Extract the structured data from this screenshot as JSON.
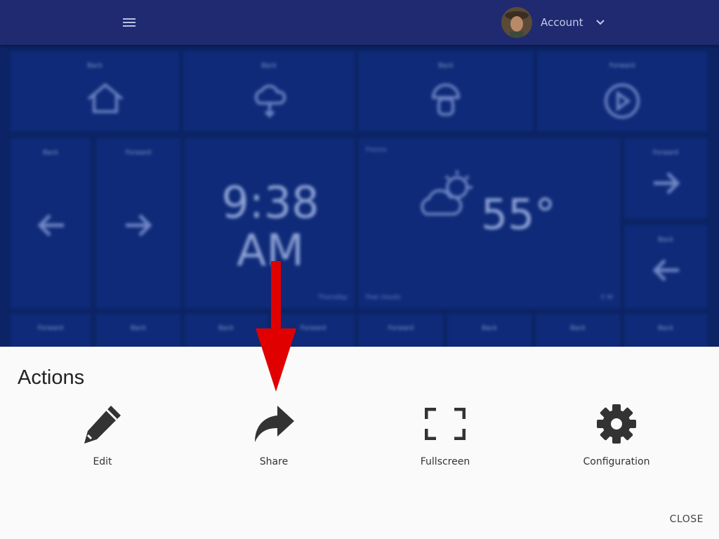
{
  "header": {
    "account_label": "Account"
  },
  "dashboard": {
    "tiles": [
      {
        "label": "Back",
        "icon": "home-icon"
      },
      {
        "label": "Back",
        "icon": "cloud-download-icon"
      },
      {
        "label": "Back",
        "icon": "mushroom-icon"
      },
      {
        "label": "Forward",
        "icon": "play-circle-icon"
      },
      {
        "label": "Back",
        "icon": "arrow-left-icon"
      },
      {
        "label": "Forward",
        "icon": "arrow-right-icon"
      },
      {
        "label": "Forward",
        "icon": "arrow-right-icon"
      },
      {
        "label": "Back",
        "icon": "arrow-left-icon"
      }
    ],
    "clock": {
      "time": "9:38",
      "period": "AM",
      "day": "Thursday"
    },
    "weather": {
      "label": "Fresno",
      "temp": "55°",
      "condition": "Few clouds",
      "wind": "5 W"
    },
    "bottom_row_labels": [
      "Forward",
      "Back",
      "Back",
      "Forward",
      "Forward",
      "Back",
      "Back",
      "Back"
    ]
  },
  "actions": {
    "title": "Actions",
    "items": [
      {
        "label": "Edit",
        "icon": "pencil-icon"
      },
      {
        "label": "Share",
        "icon": "share-icon"
      },
      {
        "label": "Fullscreen",
        "icon": "fullscreen-icon"
      },
      {
        "label": "Configuration",
        "icon": "gear-icon"
      }
    ],
    "close_label": "CLOSE"
  },
  "colors": {
    "header_bg": "#1f2a70",
    "dashboard_bg": "#0c2466",
    "sheet_bg": "#fafafa",
    "annotation_arrow": "#e00000"
  }
}
